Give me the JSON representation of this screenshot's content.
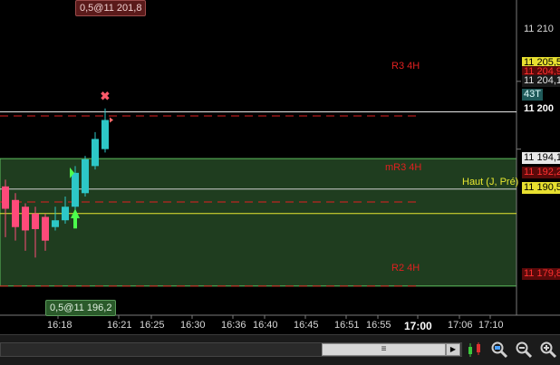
{
  "chart_data": {
    "type": "candlestick",
    "ylim": [
      11175.5,
      11222.0
    ],
    "y_ticks": [
      "11 210",
      "11 200"
    ],
    "x_ticks": [
      "16:18",
      "16:21",
      "16:25",
      "16:30",
      "16:36",
      "16:40",
      "16:45",
      "16:51",
      "16:55",
      "17:00",
      "17:06",
      "17:10"
    ],
    "x_ticks_bold": [
      "17:00"
    ],
    "candles": [
      {
        "open": 11194.5,
        "high": 11195.5,
        "low": 11187.0,
        "close": 11191.2,
        "color": "#ff4a7a"
      },
      {
        "open": 11192.5,
        "high": 11193.5,
        "low": 11186.5,
        "close": 11188.5,
        "color": "#ff4a7a"
      },
      {
        "open": 11191.5,
        "high": 11192.0,
        "low": 11185.0,
        "close": 11188.0,
        "color": "#ff4a7a"
      },
      {
        "open": 11190.5,
        "high": 11191.5,
        "low": 11184.0,
        "close": 11188.2,
        "color": "#ff4a7a"
      },
      {
        "open": 11190.0,
        "high": 11190.5,
        "low": 11185.0,
        "close": 11186.5,
        "color": "#ff4a7a"
      },
      {
        "open": 11188.5,
        "high": 11191.5,
        "low": 11188.0,
        "close": 11189.5,
        "color": "#2dc7c7"
      },
      {
        "open": 11189.5,
        "high": 11193.0,
        "low": 11189.0,
        "close": 11191.5,
        "color": "#2dc7c7"
      },
      {
        "open": 11191.5,
        "high": 11197.5,
        "low": 11189.5,
        "close": 11196.5,
        "color": "#2dc7c7"
      },
      {
        "open": 11193.5,
        "high": 11199.0,
        "low": 11193.0,
        "close": 11198.5,
        "color": "#2dc7c7"
      },
      {
        "open": 11197.5,
        "high": 11202.5,
        "low": 11197.0,
        "close": 11201.5,
        "color": "#2dc7c7"
      },
      {
        "open": 11200.0,
        "high": 11206.0,
        "low": 11199.5,
        "close": 11204.3,
        "color": "#2dc7c7"
      }
    ],
    "zone": {
      "from": 11179.8,
      "to": 11198.6,
      "color": "#1f3d1f"
    },
    "levels": [
      {
        "name": "R3 4H",
        "value": 11204.9,
        "color": "#e02020",
        "style": "dashed"
      },
      {
        "name": "mR3 4H",
        "value": 11192.2,
        "color": "#e02020",
        "style": "dashed"
      },
      {
        "name": "R2 4H",
        "value": 11179.8,
        "color": "#e02020",
        "style": "dashed"
      },
      {
        "name": "Haut (J, Pré)",
        "value": 11190.5,
        "color": "#e8e830",
        "style": "solid"
      }
    ],
    "hlines": [
      {
        "value": 11205.5,
        "color": "#e8e8e8"
      },
      {
        "value": 11194.1,
        "color": "#cfcfcf"
      }
    ],
    "price_tags": [
      {
        "text": "11 205,5",
        "bg": "#e8e030",
        "fg": "#000000"
      },
      {
        "text": "11 204,9",
        "bg": "#5a0a0a",
        "fg": "#ff3030"
      },
      {
        "text": "11 204,1",
        "bg": "#1a1a1a",
        "fg": "#e0e0e0"
      },
      {
        "text": "11 194,1",
        "bg": "#e8e8e8",
        "fg": "#000000"
      },
      {
        "text": "11 192,2",
        "bg": "#5a0a0a",
        "fg": "#ff3030"
      },
      {
        "text": "11 190,5",
        "bg": "#e8e030",
        "fg": "#000000"
      },
      {
        "text": "11 179,8",
        "bg": "#5a0a0a",
        "fg": "#ff3030"
      }
    ],
    "counter_badge": "43T",
    "order_top": "0,5@11 201,8",
    "order_bottom": "0,5@11 196,2"
  },
  "toolbar": {
    "scroll_grip": "≡",
    "scroll_right": "▶",
    "icons": [
      "candle-style-icon",
      "zoom-fit-icon",
      "zoom-out-icon",
      "zoom-in-icon"
    ]
  }
}
